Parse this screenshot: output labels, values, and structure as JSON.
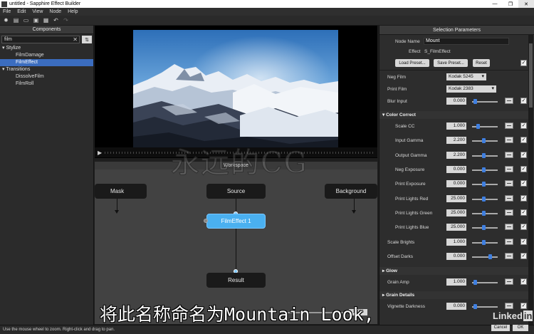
{
  "window": {
    "title": "untitled - Sapphire Effect Builder",
    "controls": [
      "—",
      "❐",
      "✕"
    ]
  },
  "menu": [
    "File",
    "Edit",
    "View",
    "Node",
    "Help"
  ],
  "components": {
    "header": "Components",
    "search_value": "film",
    "tree": [
      {
        "label": "Stylize",
        "type": "category"
      },
      {
        "label": "FilmDamage",
        "type": "item"
      },
      {
        "label": "FilmEffect",
        "type": "item",
        "selected": true
      },
      {
        "label": "Transitions",
        "type": "category"
      },
      {
        "label": "DissolveFilm",
        "type": "item"
      },
      {
        "label": "FilmRoll",
        "type": "item"
      }
    ]
  },
  "workspace": {
    "header": "Workspace",
    "nodes": {
      "mask": "Mask",
      "source": "Source",
      "background": "Background",
      "effect": "FilmEffect 1",
      "result": "Result"
    },
    "zoom": "100%"
  },
  "params": {
    "header": "Selection Parameters",
    "node_name_label": "Node Name",
    "node_name_value": "Mount",
    "effect_label": "Effect",
    "effect_value": "S_FilmEffect",
    "load_preset": "Load Preset...",
    "save_preset": "Save Preset...",
    "reset": "Reset",
    "neg_film_label": "Neg Film",
    "neg_film_value": "Kodak 5245",
    "print_film_label": "Print Film",
    "print_film_value": "Kodak 2383",
    "blur_input": {
      "label": "Blur Input",
      "value": "0.000",
      "pos": 0.05
    },
    "color_correct_section": "Color Correct",
    "color_correct": [
      {
        "label": "Scale CC",
        "value": "1.000",
        "pos": 0.2
      },
      {
        "label": "Input Gamma",
        "value": "2.200",
        "pos": 0.45
      },
      {
        "label": "Output Gamma",
        "value": "2.200",
        "pos": 0.45
      },
      {
        "label": "Neg Exposure",
        "value": "0.000",
        "pos": 0.45
      },
      {
        "label": "Print Exposure",
        "value": "0.000",
        "pos": 0.45
      },
      {
        "label": "Print Lights Red",
        "value": "25.000",
        "pos": 0.45
      },
      {
        "label": "Print Lights Green",
        "value": "25.000",
        "pos": 0.45
      },
      {
        "label": "Print Lights Blue",
        "value": "25.000",
        "pos": 0.45
      }
    ],
    "scale_brights": {
      "label": "Scale Brights",
      "value": "1.000",
      "pos": 0.45
    },
    "offset_darks": {
      "label": "Offset Darks",
      "value": "0.000",
      "pos": 0.75
    },
    "glow_section": "Glow",
    "grain_amp": {
      "label": "Grain Amp",
      "value": "1.000",
      "pos": 0.05
    },
    "grain_details_section": "Grain Details",
    "vignette_darkness": {
      "label": "Vignette Darkness",
      "value": "0.000",
      "pos": 0.05
    },
    "cancel": "Cancel",
    "ok": "OK"
  },
  "status": "Use the mouse wheel to zoom.  Right-click and drag to pan.",
  "overlay": {
    "watermark": "永远的CG",
    "subtitle": "将此名称命名为Mountain Look,",
    "brand": "Linked",
    "brand_in": "in"
  }
}
